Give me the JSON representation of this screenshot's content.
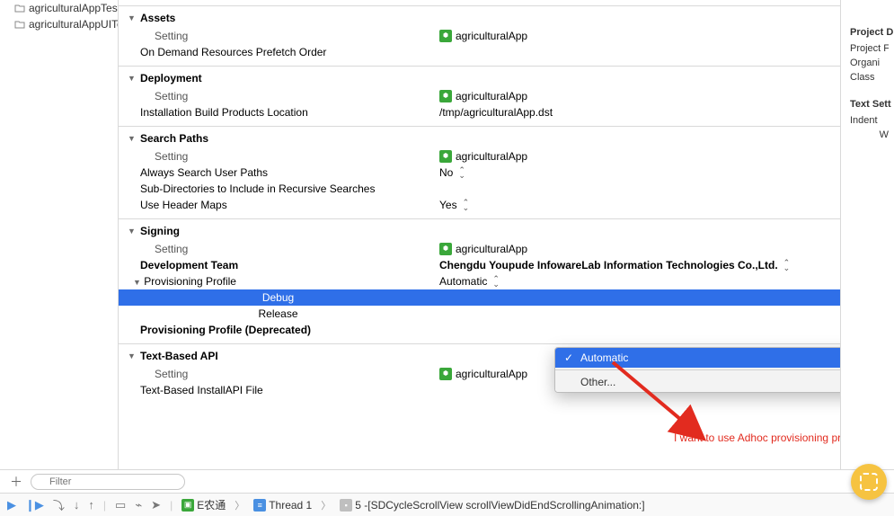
{
  "nav": {
    "items": [
      {
        "label": "agriculturalAppTests"
      },
      {
        "label": "agriculturalAppUITe..."
      }
    ]
  },
  "app_target": "agriculturalApp",
  "sections": {
    "assets": {
      "title": "Assets",
      "setting_label": "Setting",
      "rows": [
        {
          "label": "On Demand Resources Prefetch Order",
          "value": ""
        }
      ]
    },
    "deployment": {
      "title": "Deployment",
      "setting_label": "Setting",
      "rows": [
        {
          "label": "Installation Build Products Location",
          "value": "/tmp/agriculturalApp.dst"
        }
      ]
    },
    "search_paths": {
      "title": "Search Paths",
      "setting_label": "Setting",
      "rows": [
        {
          "label": "Always Search User Paths",
          "value": "No",
          "popup": true
        },
        {
          "label": "Sub-Directories to Include in Recursive Searches",
          "value": ""
        },
        {
          "label": "Use Header Maps",
          "value": "Yes",
          "popup": true
        }
      ]
    },
    "signing": {
      "title": "Signing",
      "setting_label": "Setting",
      "dev_team_label": "Development Team",
      "dev_team_value": "Chengdu Youpude InfowareLab Information Technologies Co.,Ltd.",
      "prov_profile_label": "Provisioning Profile",
      "prov_profile_value": "Automatic",
      "debug_label": "Debug",
      "release_label": "Release",
      "prov_profile_deprecated_label": "Provisioning Profile (Deprecated)"
    },
    "text_api": {
      "title": "Text-Based API",
      "setting_label": "Setting",
      "rows": [
        {
          "label": "Text-Based InstallAPI File",
          "value": ""
        }
      ]
    }
  },
  "dropdown": {
    "items": [
      "Automatic",
      "Other..."
    ],
    "selected": "Automatic"
  },
  "annotation": "I want to use Adhoc provisioning profile here",
  "inspector": {
    "header1": "Project D",
    "fields1": [
      "Project F",
      "Organi",
      "Class"
    ],
    "header2": "Text Sett",
    "fields2": [
      "Indent",
      "W"
    ]
  },
  "filter": {
    "placeholder": "Filter"
  },
  "debugbar": {
    "target": "E农通",
    "thread": "Thread 1",
    "frame": "5 -[SDCycleScrollView scrollViewDidEndScrollingAnimation:]"
  }
}
